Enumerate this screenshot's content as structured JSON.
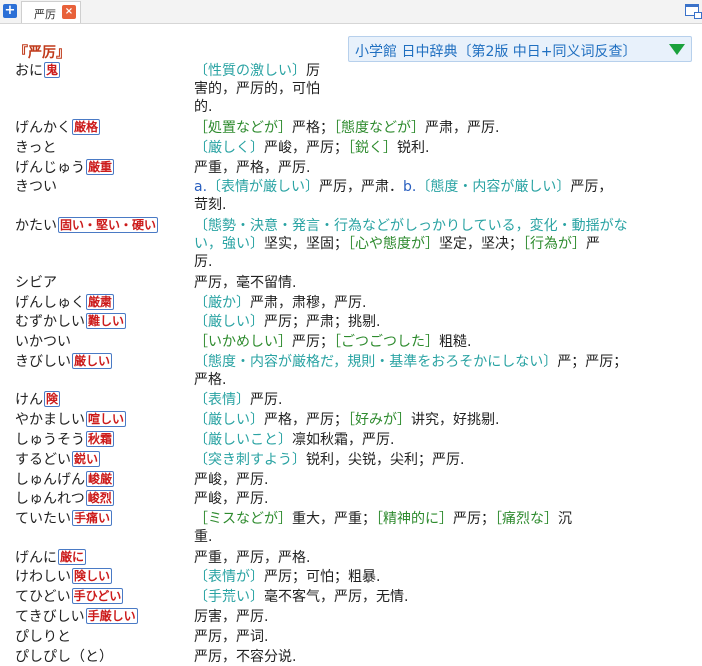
{
  "tab": {
    "add_label": "+",
    "label": "严厉",
    "close_label": "×"
  },
  "dictionary": {
    "name": "小学館 日中辞典〔第2版 中日+同义词反查〕"
  },
  "headword": "『严厉』",
  "entries": [
    {
      "reading": "おに",
      "kanji": "鬼",
      "def_lines": [
        [
          {
            "t": "〔性質の激しい〕",
            "c": "t"
          },
          {
            "t": "厉"
          }
        ],
        [
          {
            "t": "害的，严厉的，可怕"
          }
        ],
        [
          {
            "t": "的."
          }
        ]
      ]
    },
    {
      "reading": "げんかく",
      "kanji": "厳格",
      "def_lines": [
        [
          {
            "t": "［処置などが］",
            "c": "g"
          },
          {
            "t": "严格；"
          },
          {
            "t": "［態度などが］",
            "c": "g"
          },
          {
            "t": "严肃，严厉."
          }
        ]
      ]
    },
    {
      "reading": "きっと",
      "kanji": "",
      "def_lines": [
        [
          {
            "t": "〔厳しく〕",
            "c": "t"
          },
          {
            "t": "严峻，严厉；"
          },
          {
            "t": "［鋭く］",
            "c": "g"
          },
          {
            "t": "锐利."
          }
        ]
      ]
    },
    {
      "reading": "げんじゅう",
      "kanji": "厳重",
      "def_lines": [
        [
          {
            "t": "严重，严格，严厉."
          }
        ]
      ]
    },
    {
      "reading": "きつい",
      "kanji": "",
      "def_lines": [
        [
          {
            "t": "a.",
            "c": "n"
          },
          {
            "t": "〔表情が厳しい〕",
            "c": "t"
          },
          {
            "t": "严厉，严肃．"
          },
          {
            "t": "b.",
            "c": "n"
          },
          {
            "t": "〔態度・内容が厳しい〕",
            "c": "t"
          },
          {
            "t": "严厉，"
          }
        ],
        [
          {
            "t": "苛刻."
          }
        ]
      ]
    },
    {
      "reading": "かたい",
      "kanji": "固い・堅い・硬い",
      "def_lines": [
        [
          {
            "t": "〔態勢・決意・発言・行為などがしっかりしている，変化・動揺がな",
            "c": "t"
          }
        ],
        [
          {
            "t": "い，強い〕",
            "c": "t"
          },
          {
            "t": "坚实，坚固；"
          },
          {
            "t": "［心や態度が］",
            "c": "g"
          },
          {
            "t": "坚定，坚决；"
          },
          {
            "t": "［行為が］",
            "c": "g"
          },
          {
            "t": "严"
          }
        ],
        [
          {
            "t": "厉."
          }
        ]
      ]
    },
    {
      "reading": "シビア",
      "kanji": "",
      "def_lines": [
        [
          {
            "t": "严厉，毫不留情."
          }
        ]
      ]
    },
    {
      "reading": "げんしゅく",
      "kanji": "厳粛",
      "def_lines": [
        [
          {
            "t": "〔厳か〕",
            "c": "t"
          },
          {
            "t": "严肃，肃穆，严厉."
          }
        ]
      ]
    },
    {
      "reading": "むずかしい",
      "kanji": "難しい",
      "def_lines": [
        [
          {
            "t": "〔厳しい〕",
            "c": "t"
          },
          {
            "t": "严厉；严肃；挑剔."
          }
        ]
      ]
    },
    {
      "reading": "いかつい",
      "kanji": "",
      "def_lines": [
        [
          {
            "t": "［いかめしい］",
            "c": "g"
          },
          {
            "t": "严厉；"
          },
          {
            "t": "［ごつごつした］",
            "c": "g"
          },
          {
            "t": "粗糙."
          }
        ]
      ]
    },
    {
      "reading": "きびしい",
      "kanji": "厳しい",
      "def_lines": [
        [
          {
            "t": "〔態度・内容が厳格だ，規則・基準をおろそかにしない〕",
            "c": "t"
          },
          {
            "t": "严；严厉；"
          }
        ],
        [
          {
            "t": "严格."
          }
        ]
      ]
    },
    {
      "reading": "けん",
      "kanji": "険",
      "def_lines": [
        [
          {
            "t": "〔表情〕",
            "c": "t"
          },
          {
            "t": "严厉."
          }
        ]
      ]
    },
    {
      "reading": "やかましい",
      "kanji": "喧しい",
      "def_lines": [
        [
          {
            "t": "〔厳しい〕",
            "c": "t"
          },
          {
            "t": "严格，严厉；"
          },
          {
            "t": "［好みが］",
            "c": "g"
          },
          {
            "t": "讲究，好挑剔."
          }
        ]
      ]
    },
    {
      "reading": "しゅうそう",
      "kanji": "秋霜",
      "def_lines": [
        [
          {
            "t": "〔厳しいこと〕",
            "c": "t"
          },
          {
            "t": "凛如秋霜，严厉."
          }
        ]
      ]
    },
    {
      "reading": "するどい",
      "kanji": "鋭い",
      "def_lines": [
        [
          {
            "t": "〔突き刺すよう〕",
            "c": "t"
          },
          {
            "t": "锐利，尖锐，尖利；严厉."
          }
        ]
      ]
    },
    {
      "reading": "しゅんげん",
      "kanji": "峻厳",
      "def_lines": [
        [
          {
            "t": "严峻，严厉."
          }
        ]
      ]
    },
    {
      "reading": "しゅんれつ",
      "kanji": "峻烈",
      "def_lines": [
        [
          {
            "t": "严峻，严厉."
          }
        ]
      ]
    },
    {
      "reading": "ていたい",
      "kanji": "手痛い",
      "def_lines": [
        [
          {
            "t": "［ミスなどが］",
            "c": "g"
          },
          {
            "t": "重大，严重；"
          },
          {
            "t": "［精神的に］",
            "c": "g"
          },
          {
            "t": "严厉；"
          },
          {
            "t": "［痛烈な］",
            "c": "g"
          },
          {
            "t": "沉"
          }
        ],
        [
          {
            "t": "重."
          }
        ]
      ]
    },
    {
      "reading": "げんに",
      "kanji": "厳に",
      "def_lines": [
        [
          {
            "t": "严重，严厉，严格."
          }
        ]
      ]
    },
    {
      "reading": "けわしい",
      "kanji": "険しい",
      "def_lines": [
        [
          {
            "t": "〔表情が〕",
            "c": "t"
          },
          {
            "t": "严厉；可怕；粗暴."
          }
        ]
      ]
    },
    {
      "reading": "てひどい",
      "kanji": "手ひどい",
      "def_lines": [
        [
          {
            "t": "〔手荒い〕",
            "c": "t"
          },
          {
            "t": "毫不客气，严厉，无情."
          }
        ]
      ]
    },
    {
      "reading": "てきびしい",
      "kanji": "手厳しい",
      "def_lines": [
        [
          {
            "t": "厉害，严厉."
          }
        ]
      ]
    },
    {
      "reading": "ぴしりと",
      "kanji": "",
      "def_lines": [
        [
          {
            "t": "严厉，严词."
          }
        ]
      ]
    },
    {
      "reading": "ぴしぴし（と）",
      "kanji": "",
      "def_lines": [
        [
          {
            "t": "严厉，不容分说."
          }
        ]
      ]
    }
  ]
}
